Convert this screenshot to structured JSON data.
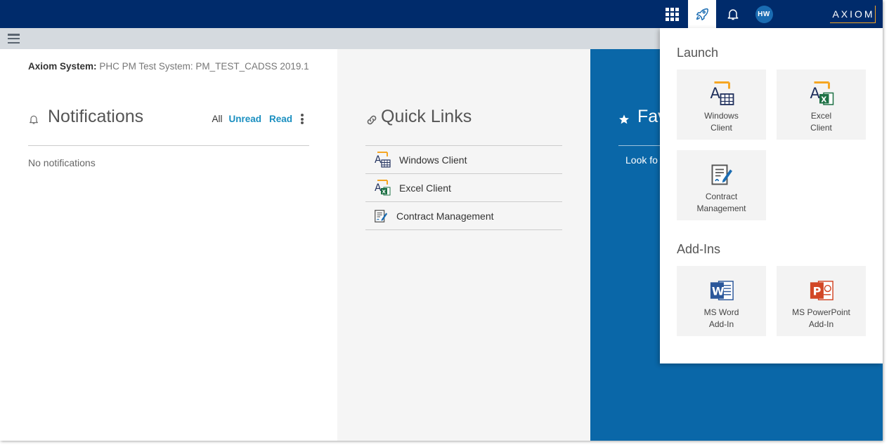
{
  "topbar": {
    "avatar_initials": "HW",
    "brand": "AXIOM",
    "colors": {
      "bar": "#002b6b",
      "brand_accent": "#f5a623",
      "avatar": "#1a6cb2"
    },
    "icons": [
      "apps-grid-icon",
      "rocket-icon",
      "bell-icon"
    ]
  },
  "system": {
    "label": "Axiom System:",
    "value": "PHC PM Test System: PM_TEST_CADSS 2019.1"
  },
  "notifications": {
    "title": "Notifications",
    "filters": {
      "all": "All",
      "unread": "Unread",
      "read": "Read"
    },
    "empty_text": "No notifications"
  },
  "quick_links": {
    "title": "Quick Links",
    "items": [
      {
        "label": "Windows Client",
        "icon": "windows-client-icon"
      },
      {
        "label": "Excel Client",
        "icon": "excel-client-icon"
      },
      {
        "label": "Contract Management",
        "icon": "contract-management-icon"
      }
    ]
  },
  "favorites": {
    "title": "Fav",
    "text": "Look fo",
    "color": "#0a67a8"
  },
  "launch_panel": {
    "launch_heading": "Launch",
    "launch_tiles": [
      {
        "line1": "Windows",
        "line2": "Client"
      },
      {
        "line1": "Excel",
        "line2": "Client"
      },
      {
        "line1": "Contract",
        "line2": "Management"
      }
    ],
    "addins_heading": "Add-Ins",
    "addin_tiles": [
      {
        "line1": "MS Word",
        "line2": "Add-In"
      },
      {
        "line1": "MS PowerPoint",
        "line2": "Add-In"
      }
    ]
  }
}
